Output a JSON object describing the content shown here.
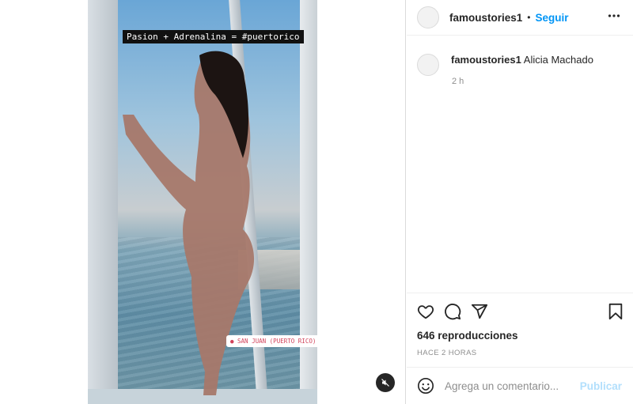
{
  "post": {
    "caption_sticker": "Pasion + Adrenalina = #puertorico",
    "location_sticker": "● SAN JUAN (PUERTO RICO)"
  },
  "header": {
    "username": "famoustories1",
    "separator": "•",
    "follow_label": "Seguir"
  },
  "comment": {
    "username": "famoustories1",
    "text": "Alicia Machado",
    "time": "2 h"
  },
  "stats": {
    "views": "646 reproducciones",
    "posted_ago": "HACE 2 HORAS"
  },
  "composer": {
    "placeholder": "Agrega un comentario...",
    "post_label": "Publicar"
  },
  "colors": {
    "accent": "#0095f6",
    "accent_disabled": "#b2dffc",
    "text": "#262626",
    "muted": "#8e8e8e"
  },
  "icons": [
    "mute-icon",
    "more-options-icon",
    "heart-icon",
    "comment-icon",
    "share-icon",
    "bookmark-icon",
    "emoji-icon"
  ]
}
